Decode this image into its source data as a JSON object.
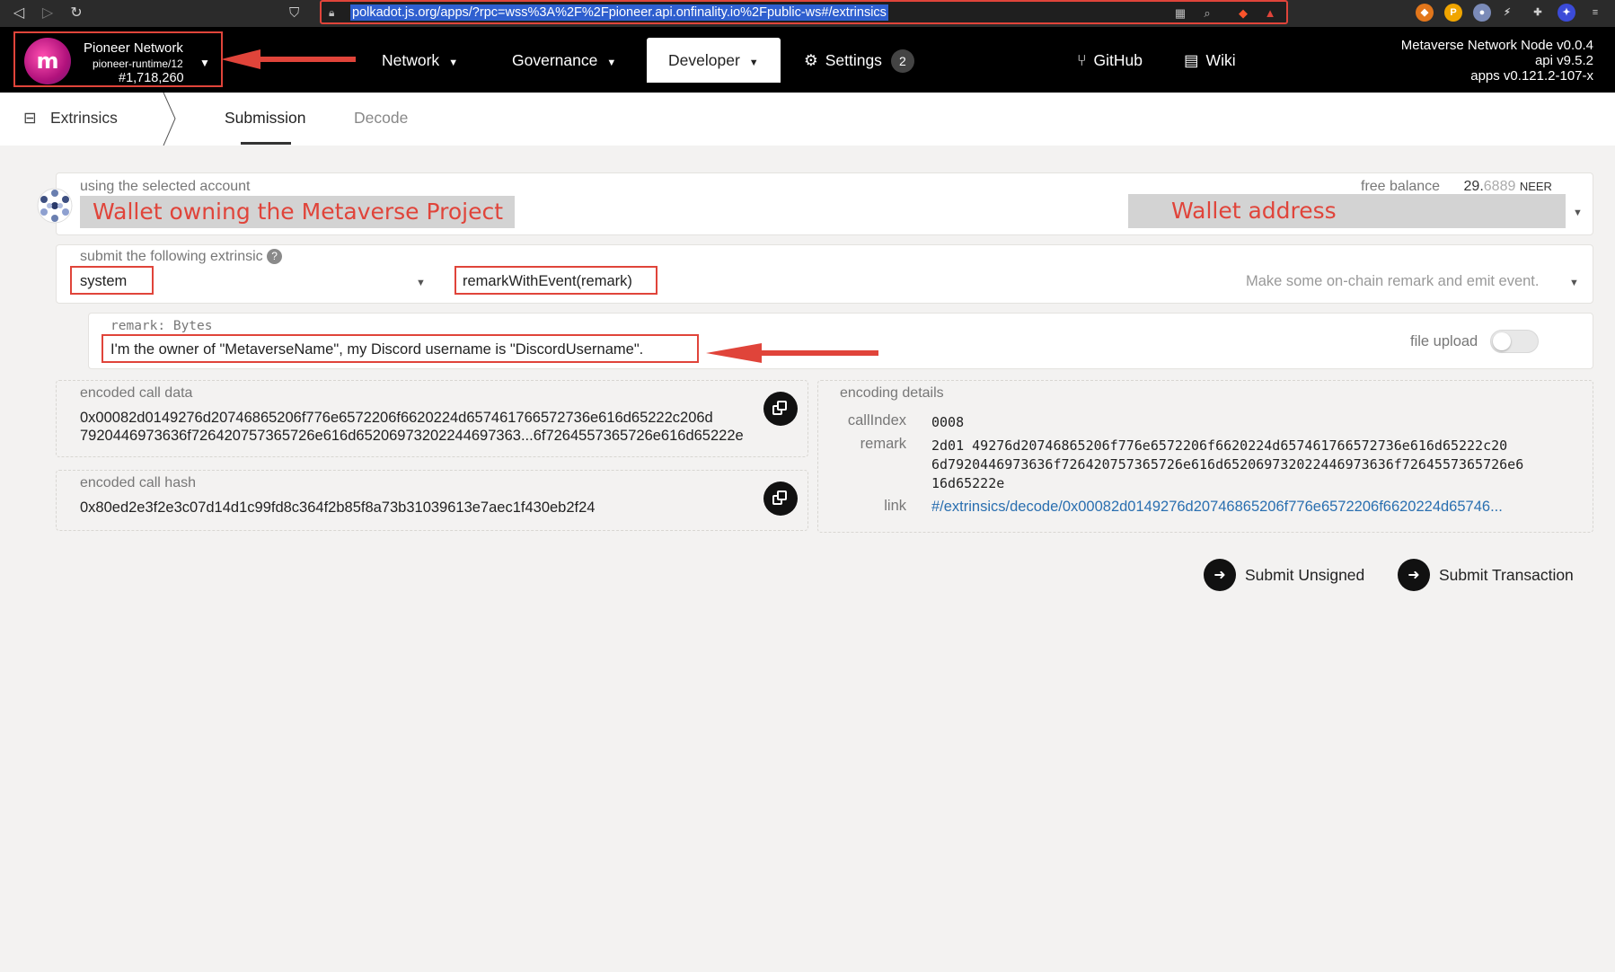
{
  "browser": {
    "url": "polkadot.js.org/apps/?rpc=wss%3A%2F%2Fpioneer.api.onfinality.io%2Fpublic-ws#/extrinsics"
  },
  "header": {
    "chain_name": "Pioneer Network",
    "runtime": "pioneer-runtime/12",
    "block": "#1,718,260",
    "logo_text": "m",
    "menu": {
      "network": "Network",
      "governance": "Governance",
      "developer": "Developer",
      "settings": "Settings",
      "settings_badge": "2",
      "github": "GitHub",
      "wiki": "Wiki"
    },
    "node_info": {
      "node": "Metaverse Network Node v0.0.4",
      "api": "api v9.5.2",
      "apps": "apps v0.121.2-107-x"
    }
  },
  "subnav": {
    "section": "Extrinsics",
    "tabs": [
      "Submission",
      "Decode"
    ]
  },
  "account": {
    "label": "using the selected account",
    "annotation_owner": "Wallet owning the Metaverse Project",
    "annotation_address": "Wallet address",
    "free_balance_label": "free balance",
    "balance_int": "29.",
    "balance_dec": "6889",
    "balance_unit": "NEER"
  },
  "extrinsic": {
    "label": "submit the following extrinsic",
    "help": "?",
    "module": "system",
    "method": "remarkWithEvent(remark)",
    "description": "Make some on-chain remark and emit event."
  },
  "remark": {
    "label": "remark: Bytes",
    "value": "I'm the owner of \"MetaverseName\", my Discord username is \"DiscordUsername\".",
    "file_upload": "file upload"
  },
  "encoded_call_data": {
    "label": "encoded call data",
    "line1": "0x00082d0149276d20746865206f776e6572206f6620224d657461766572736e616d65222c206d",
    "line2": "7920446973636f726420757365726e616d65206973202244697363...6f7264557365726e616d65222e"
  },
  "encoded_call_hash": {
    "label": "encoded call hash",
    "value": "0x80ed2e3f2e3c07d14d1c99fd8c364f2b85f8a73b31039613e7aec1f430eb2f24"
  },
  "encoding_details": {
    "label": "encoding details",
    "call_index_label": "callIndex",
    "call_index": "0008",
    "remark_label": "remark",
    "remark_line1": "2d01 49276d20746865206f776e6572206f6620224d657461766572736e616d65222c20",
    "remark_line2": "6d7920446973636f726420757365726e616d652069732022446973636f7264557365726e6",
    "remark_line3": "16d65222e",
    "link_label": "link",
    "link": "#/extrinsics/decode/0x00082d0149276d20746865206f776e6572206f6620224d65746..."
  },
  "actions": {
    "submit_unsigned": "Submit Unsigned",
    "submit_transaction": "Submit Transaction"
  },
  "colors": {
    "annotation_red": "#e0443a",
    "header_bg": "#000000",
    "link_blue": "#2a6fb0"
  }
}
